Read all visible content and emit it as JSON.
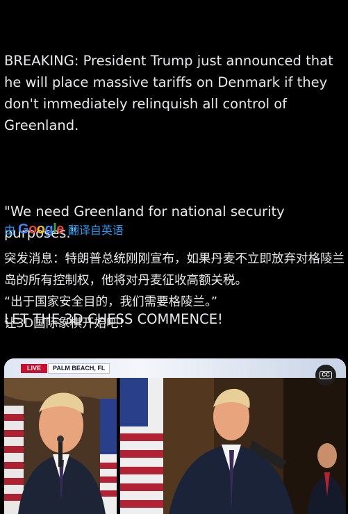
{
  "post": {
    "p1": "BREAKING: President Trump just announced that he will place massive tariffs on Denmark if they don't immediately relinquish all control of Greenland.",
    "p2": "\"We need Greenland for national security purposes.\"",
    "p3": "LET THE 3D CHESS COMMENCE!"
  },
  "translate": {
    "by": "由",
    "brand": "Google",
    "action": "翻译自英语"
  },
  "translation": {
    "p1": "突发消息：特朗普总统刚刚宣布，如果丹麦不立即放弃对格陵兰岛的所有控制权，他将对丹麦征收高额关税。",
    "p2": "“出于国家安全目的，我们需要格陵兰。”",
    "p3": "让3D国际象棋开始吧！"
  },
  "video": {
    "live_label": "LIVE",
    "location": "PALM BEACH, FL",
    "cc_label": "CC"
  },
  "colors": {
    "link": "#1d9bf0",
    "live_red": "#c8102e",
    "google_blue": "#4285F4",
    "google_red": "#EA4335",
    "google_yellow": "#FBBC05",
    "google_green": "#34A853"
  }
}
